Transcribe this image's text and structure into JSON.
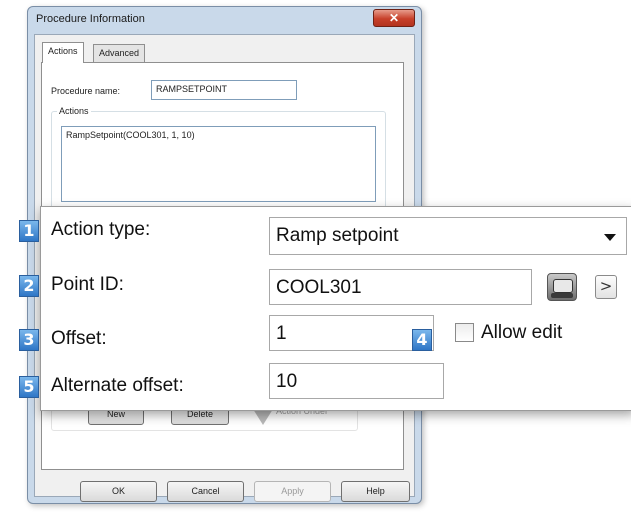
{
  "dialog": {
    "title": "Procedure Information",
    "close_glyph": "✕",
    "tabs": [
      {
        "label": "Actions",
        "active": true
      },
      {
        "label": "Advanced",
        "active": false
      }
    ],
    "procedure_name_label": "Procedure name:",
    "procedure_name_value": "RAMPSETPOINT",
    "actions_group_label": "Actions",
    "actions_list": [
      "RampSetpoint(COOL301, 1, 10)"
    ],
    "action_buttons": {
      "new": "New",
      "delete": "Delete"
    },
    "action_under_label": "Action Under",
    "footer_buttons": {
      "ok": "OK",
      "cancel": "Cancel",
      "apply": "Apply",
      "help": "Help"
    }
  },
  "callout": {
    "rows": [
      {
        "badge": "1",
        "label": "Action type:",
        "value": "Ramp setpoint"
      },
      {
        "badge": "2",
        "label": "Point ID:",
        "value": "COOL301"
      },
      {
        "badge": "3",
        "label": "Offset:",
        "value": "1"
      },
      {
        "badge": "5",
        "label": "Alternate offset:",
        "value": "10"
      }
    ],
    "allow_edit": {
      "badge": "4",
      "label": "Allow edit",
      "checked": false
    },
    "browse_glyph": ">"
  },
  "colors": {
    "badge": "#2f76c6",
    "dialog_frame": "#c9d9ea",
    "close_button": "#c7402a"
  },
  "icons": {
    "point_picker": "point-browser-icon",
    "browse": "chevron-right-icon",
    "dropdown": "chevron-down-icon",
    "action_under": "arrow-down-icon"
  }
}
